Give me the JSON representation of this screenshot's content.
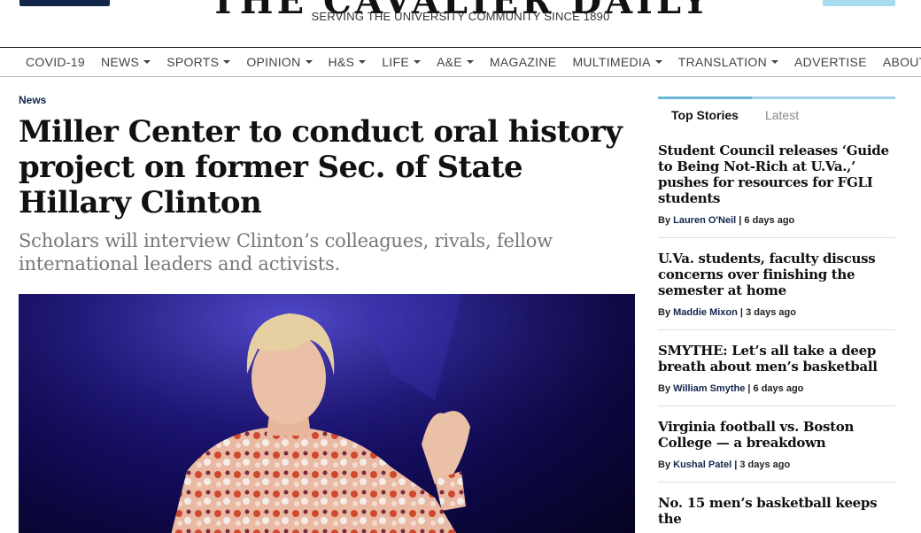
{
  "masthead": {
    "title": "THE CAVALIER DAILY",
    "tagline": "SERVING THE UNIVERSITY COMMUNITY SINCE 1890"
  },
  "nav": {
    "items": [
      {
        "label": "COVID-19",
        "dropdown": false
      },
      {
        "label": "NEWS",
        "dropdown": true
      },
      {
        "label": "SPORTS",
        "dropdown": true
      },
      {
        "label": "OPINION",
        "dropdown": true
      },
      {
        "label": "H&S",
        "dropdown": true
      },
      {
        "label": "LIFE",
        "dropdown": true
      },
      {
        "label": "A&E",
        "dropdown": true
      },
      {
        "label": "MAGAZINE",
        "dropdown": false
      },
      {
        "label": "MULTIMEDIA",
        "dropdown": true
      },
      {
        "label": "TRANSLATION",
        "dropdown": true
      },
      {
        "label": "ADVERTISE",
        "dropdown": false
      },
      {
        "label": "ABOUT",
        "dropdown": true
      }
    ]
  },
  "article": {
    "section": "News",
    "headline": "Miller Center to conduct oral history project on former Sec. of State Hillary Clinton",
    "dek": "Scholars will interview Clinton’s colleagues, rivals, fellow international leaders and activists."
  },
  "sidebar": {
    "tabs": [
      "Top Stories",
      "Latest"
    ],
    "by_prefix": "By",
    "stories": [
      {
        "title": "Student Council releases ‘Guide to Being Not-Rich at U.Va.,’ pushes for resources for FGLI students",
        "author": "Lauren O'Neil",
        "time": "6 days ago"
      },
      {
        "title": "U.Va. students, faculty discuss concerns over finishing the semester at home",
        "author": "Maddie Mixon",
        "time": "3 days ago"
      },
      {
        "title": "SMYTHE: Let’s all take a deep breath about men’s basketball",
        "author": "William Smythe",
        "time": "6 days ago"
      },
      {
        "title": "Virginia football vs. Boston College — a breakdown",
        "author": "Kushal Patel",
        "time": "3 days ago"
      },
      {
        "title": "No. 15 men’s basketball keeps the",
        "author": "",
        "time": ""
      }
    ]
  },
  "colors": {
    "navy": "#12264b",
    "accent_light_blue": "#9fd0e6",
    "dek_gray": "#777777"
  }
}
